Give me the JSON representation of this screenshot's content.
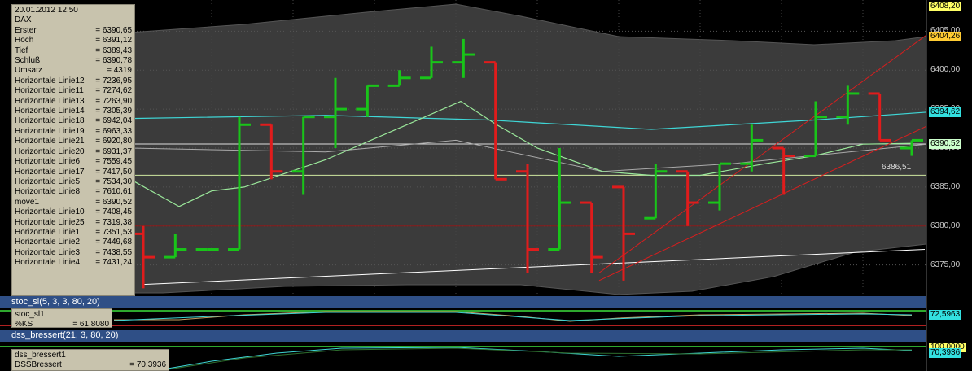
{
  "info_box": {
    "header": "20.01.2012    12:50",
    "rows": [
      {
        "k": "DAX",
        "v": ""
      },
      {
        "k": "Erster",
        "v": "=      6390,65"
      },
      {
        "k": "Hoch",
        "v": "=      6391,12"
      },
      {
        "k": "Tief",
        "v": "=      6389,43"
      },
      {
        "k": "Schluß",
        "v": "=      6390,78"
      },
      {
        "k": "Umsatz",
        "v": "=          4319"
      },
      {
        "k": "Horizontale Linie12",
        "v": "=  7236,95"
      },
      {
        "k": "Horizontale Linie11",
        "v": "=  7274,62"
      },
      {
        "k": "Horizontale Linie13",
        "v": "=  7263,90"
      },
      {
        "k": "Horizontale Linie14",
        "v": "=  7305,39"
      },
      {
        "k": "Horizontale Linie18",
        "v": "=  6942,04"
      },
      {
        "k": "Horizontale Linie19",
        "v": "=  6963,33"
      },
      {
        "k": "Horizontale Linie21",
        "v": "=  6920,80"
      },
      {
        "k": "Horizontale Linie20",
        "v": "=  6931,37"
      },
      {
        "k": "Horizontale Linie6",
        "v": "=  7559,45"
      },
      {
        "k": "Horizontale Linie17",
        "v": "=  7417,50"
      },
      {
        "k": "Horizontale Linie5",
        "v": "=  7534,30"
      },
      {
        "k": "Horizontale Linie8",
        "v": "=  7610,61"
      },
      {
        "k": "move1",
        "v": "=  6390,52"
      },
      {
        "k": "Horizontale Linie10",
        "v": "=  7408,45"
      },
      {
        "k": "Horizontale Linie25",
        "v": "=  7319,38"
      },
      {
        "k": "Horizontale Linie1",
        "v": "=  7351,53"
      },
      {
        "k": "Horizontale Linie2",
        "v": "=  7449,68"
      },
      {
        "k": "Horizontale Linie3",
        "v": "=  7438,55"
      },
      {
        "k": "Horizontale Linie4",
        "v": "=  7431,24"
      }
    ]
  },
  "price_axis": {
    "ticks": [
      "6375,00",
      "6380,00",
      "6385,00",
      "6390,00",
      "6395,00",
      "6400,00",
      "6405,00"
    ],
    "tags": [
      {
        "text": "6408,20",
        "color": "#ffff66"
      },
      {
        "text": "6404,26",
        "color": "#ffcc33"
      },
      {
        "text": "6394,62",
        "color": "#33e0e0"
      },
      {
        "text": "6390,52",
        "color": "#ccffcc"
      }
    ]
  },
  "chart_label": "6386,51",
  "stoc_panel": {
    "header": "stoc_sl(5, 3, 3, 80, 20)",
    "box_title": "stoc_sl1",
    "box_key": "%KS",
    "box_value": "= 61,8080",
    "axis_tag": "72,5963"
  },
  "dss_panel": {
    "header": "dss_bressert(21, 3, 80, 20)",
    "box_title": "dss_bressert1",
    "box_key": "DSSBressert",
    "box_value": "= 70,3936",
    "axis_tag_top": "100,0000",
    "axis_tag": "70,3936"
  },
  "colors": {
    "up_bar": "#19c419",
    "down_bar": "#e01c1c",
    "envelope": "#3b3b3b",
    "cyan_line": "#3fd6d6",
    "green_line": "#9be89b",
    "channel": "#d81e1e"
  },
  "chart_data": {
    "type": "ohlc",
    "ylim": [
      6371,
      6409
    ],
    "bars": [
      {
        "o": 6379,
        "h": 6380,
        "l": 6372,
        "c": 6376,
        "dir": "down"
      },
      {
        "o": 6376,
        "h": 6379,
        "l": 6376,
        "c": 6377,
        "dir": "up"
      },
      {
        "o": 6377,
        "h": 6377,
        "l": 6377,
        "c": 6377,
        "dir": "up"
      },
      {
        "o": 6377,
        "h": 6394,
        "l": 6377,
        "c": 6393,
        "dir": "up"
      },
      {
        "o": 6393,
        "h": 6393,
        "l": 6386,
        "c": 6387,
        "dir": "down"
      },
      {
        "o": 6387,
        "h": 6394,
        "l": 6384,
        "c": 6394,
        "dir": "up"
      },
      {
        "o": 6394,
        "h": 6399,
        "l": 6390,
        "c": 6395,
        "dir": "up"
      },
      {
        "o": 6395,
        "h": 6398,
        "l": 6394,
        "c": 6398,
        "dir": "up"
      },
      {
        "o": 6398,
        "h": 6400,
        "l": 6398,
        "c": 6399,
        "dir": "up"
      },
      {
        "o": 6399,
        "h": 6403,
        "l": 6399,
        "c": 6401,
        "dir": "up"
      },
      {
        "o": 6401,
        "h": 6404,
        "l": 6399,
        "c": 6402,
        "dir": "up"
      },
      {
        "o": 6401,
        "h": 6401,
        "l": 6386,
        "c": 6386,
        "dir": "down"
      },
      {
        "o": 6387,
        "h": 6388,
        "l": 6374,
        "c": 6377,
        "dir": "down"
      },
      {
        "o": 6377,
        "h": 6390,
        "l": 6377,
        "c": 6383,
        "dir": "up"
      },
      {
        "o": 6383,
        "h": 6383,
        "l": 6374,
        "c": 6376,
        "dir": "down"
      },
      {
        "o": 6385,
        "h": 6385,
        "l": 6373,
        "c": 6379,
        "dir": "down"
      },
      {
        "o": 6381,
        "h": 6388,
        "l": 6381,
        "c": 6387,
        "dir": "up"
      },
      {
        "o": 6387,
        "h": 6387,
        "l": 6380,
        "c": 6383,
        "dir": "down"
      },
      {
        "o": 6383,
        "h": 6388,
        "l": 6382,
        "c": 6388,
        "dir": "up"
      },
      {
        "o": 6388,
        "h": 6393,
        "l": 6387,
        "c": 6391,
        "dir": "up"
      },
      {
        "o": 6390,
        "h": 6390,
        "l": 6384,
        "c": 6389,
        "dir": "down"
      },
      {
        "o": 6389,
        "h": 6396,
        "l": 6389,
        "c": 6394,
        "dir": "up"
      },
      {
        "o": 6394,
        "h": 6398,
        "l": 6393,
        "c": 6397,
        "dir": "up"
      },
      {
        "o": 6397,
        "h": 6397,
        "l": 6391,
        "c": 6391,
        "dir": "down"
      },
      {
        "o": 6390,
        "h": 6391,
        "l": 6389,
        "c": 6391,
        "dir": "up"
      }
    ]
  }
}
